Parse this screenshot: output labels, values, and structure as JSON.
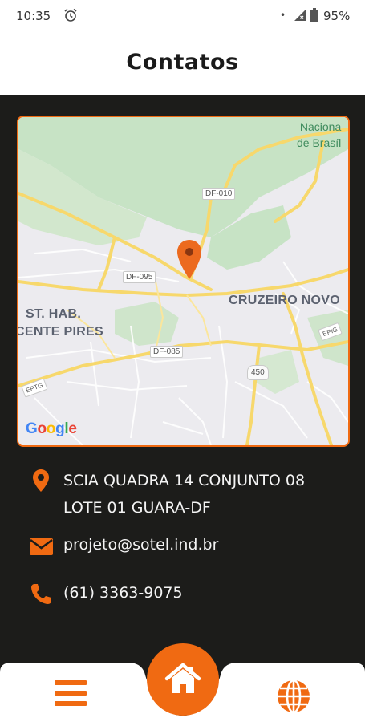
{
  "status_bar": {
    "time": "10:35",
    "alarm_icon": "alarm-clock-icon",
    "dot": "•",
    "signal_icon": "cell-signal-icon",
    "battery_icon": "battery-icon",
    "battery_level": "95%"
  },
  "header": {
    "title": "Contatos"
  },
  "map": {
    "labels": {
      "park_line1": "Naciona",
      "park_line2": "de Brasíl",
      "st_hab": "ST. HAB.",
      "vicente_pires": "CENTE PIRES",
      "cruzeiro_novo": "CRUZEIRO NOVO"
    },
    "roads": {
      "df010": "DF-010",
      "df095": "DF-095",
      "df085": "DF-085",
      "br450": "450",
      "epig": "EPIG",
      "eptg": "EPTG"
    },
    "logo": {
      "G": "G",
      "o1": "o",
      "o2": "o",
      "g": "g",
      "l": "l",
      "e": "e"
    },
    "pin_icon": "map-pin-icon"
  },
  "contacts": {
    "address_line1": "SCIA QUADRA 14 CONJUNTO 08",
    "address_line2": "LOTE 01 GUARA-DF",
    "email": "projeto@sotel.ind.br",
    "phone": "(61) 3363-9075",
    "address_icon": "location-pin-icon",
    "email_icon": "envelope-icon",
    "phone_icon": "phone-icon"
  },
  "bottom_nav": {
    "menu_icon": "hamburger-menu-icon",
    "home_icon": "home-icon",
    "globe_icon": "globe-icon"
  },
  "colors": {
    "accent": "#f06a12",
    "dark_background": "#1c1c1a",
    "text_light": "#f4f4f4"
  }
}
